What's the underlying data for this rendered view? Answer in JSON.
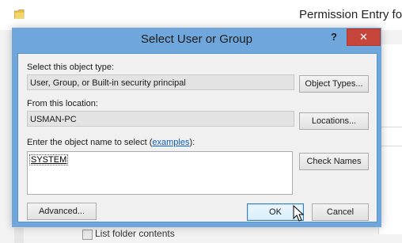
{
  "background_window": {
    "title": "Permission Entry for",
    "checkbox_label": "List folder contents"
  },
  "dialog": {
    "title": "Select User or Group",
    "help_label": "?",
    "close_label": "✕",
    "object_type": {
      "label": "Select this object type:",
      "value": "User, Group, or Built-in security principal",
      "button": "Object Types..."
    },
    "location": {
      "label": "From this location:",
      "value": "USMAN-PC",
      "button": "Locations..."
    },
    "object_name": {
      "label_prefix": "Enter the object name to select (",
      "link": "examples",
      "label_suffix": "):",
      "value": "SYSTEM",
      "check_button": "Check Names"
    },
    "buttons": {
      "advanced": "Advanced...",
      "ok": "OK",
      "cancel": "Cancel"
    }
  },
  "colors": {
    "dialog_frame": "#6fa7dc",
    "close_button": "#c7463b",
    "link": "#0a5fbf"
  }
}
